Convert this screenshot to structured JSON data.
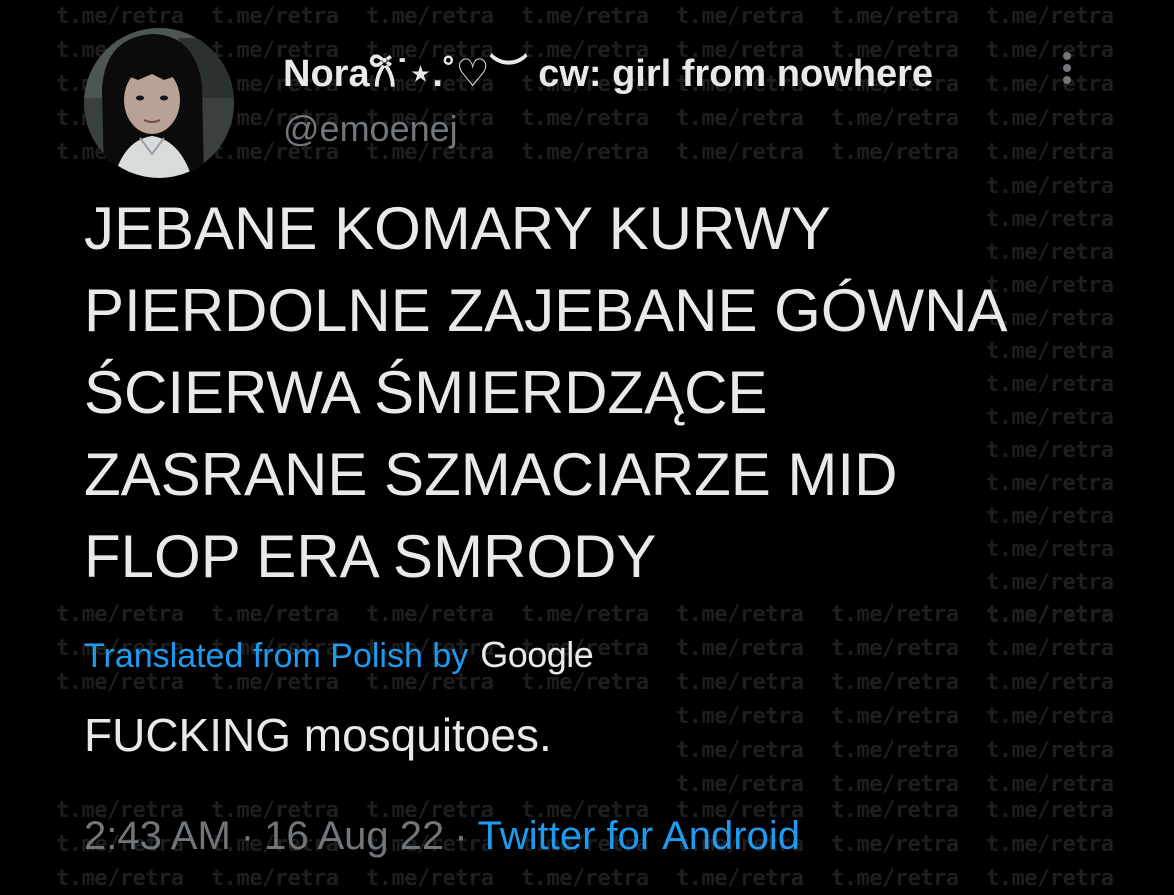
{
  "watermark": {
    "text": "t.me/retra"
  },
  "author": {
    "display_name": "Nora𐙚˙⋆.˚♡︶ cw: girl from nowhere",
    "handle": "@emoenej",
    "avatar_icon": "profile-photo",
    "more_icon": "more-vertical-icon"
  },
  "tweet": {
    "text": "JEBANE KOMARY KURWY\nPIERDOLNE ZAJEBANE GÓWNA\nŚCIERWA ŚMIERDZĄCE\nZASRANE SZMACIARZE MID\nFLOP ERA SMRODY",
    "translation_label": "Translated from Polish by",
    "translation_provider": "Google",
    "translated_text": "FUCKING mosquitoes."
  },
  "meta": {
    "time": "2:43 AM",
    "date": "16 Aug 22",
    "separator": "·",
    "source": "Twitter for Android"
  },
  "colors": {
    "background": "#000000",
    "text": "#e7e9ea",
    "secondary": "#71767b",
    "link": "#1d9bf0",
    "watermark": "#1e1e1e"
  }
}
